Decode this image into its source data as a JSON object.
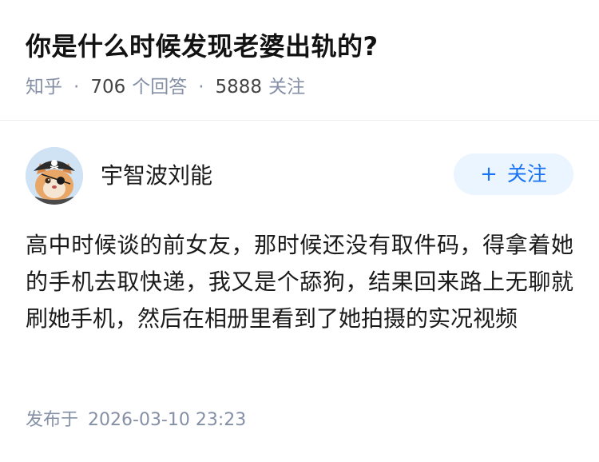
{
  "question": {
    "title": "你是什么时候发现老婆出轨的?",
    "source": "知乎",
    "answer_count": "706",
    "answer_label": "个回答",
    "follower_count": "5888",
    "follower_label": "关注",
    "separator": "·"
  },
  "author": {
    "name": "宇智波刘能",
    "avatar_icon": "pirate-cat-avatar-icon"
  },
  "follow_button": {
    "plus": "+",
    "label": "关注"
  },
  "answer": {
    "content": "高中时候谈的前女友，那时候还没有取件码，得拿着她的手机去取快递，我又是个舔狗，结果回来路上无聊就刷她手机，然后在相册里看到了她拍摄的实况视频"
  },
  "publish": {
    "label": "发布于",
    "time": "2026-03-10 23:23"
  },
  "colors": {
    "accent": "#1772f6",
    "button_bg": "#ebf5ff",
    "meta_gray": "#8590a6",
    "text": "#1a1a1a"
  }
}
